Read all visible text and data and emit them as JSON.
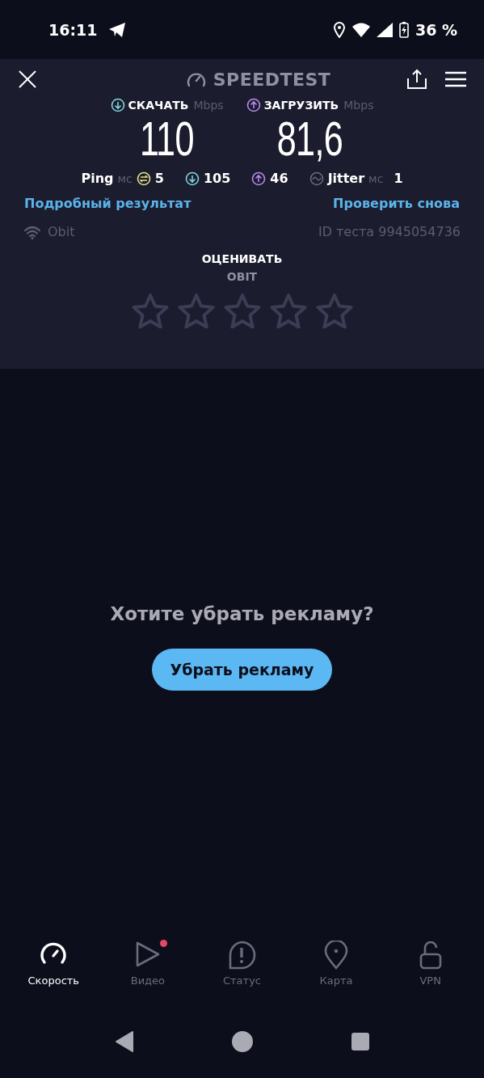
{
  "status_bar": {
    "time": "16:11",
    "battery": "36 %"
  },
  "header": {
    "title": "SPEEDTEST"
  },
  "results": [
    {
      "kind": "download",
      "label": "СКАЧАТЬ",
      "unit": "Mbps",
      "value": "110"
    },
    {
      "kind": "upload",
      "label": "ЗАГРУЗИТЬ",
      "unit": "Mbps",
      "value": "81,6"
    }
  ],
  "ping": {
    "label": "Ping",
    "unit": "мс",
    "idle": "5",
    "download": "105",
    "upload": "46"
  },
  "jitter": {
    "label": "Jitter",
    "unit": "мс",
    "value": "1"
  },
  "links": {
    "details": "Подробный результат",
    "retest": "Проверить снова"
  },
  "provider": "Obit",
  "test_id": "ID теста 9945054736",
  "rating": {
    "title": "ОЦЕНИВАТЬ",
    "subtitle": "OBIT",
    "stars": 0
  },
  "ad": {
    "question": "Хотите убрать рекламу?",
    "button": "Убрать рекламу"
  },
  "nav": [
    {
      "kind": "gauge",
      "label": "Скорость",
      "selected": true,
      "dot": false
    },
    {
      "kind": "play",
      "label": "Видео",
      "selected": false,
      "dot": true
    },
    {
      "kind": "alert",
      "label": "Статус",
      "selected": false,
      "dot": false
    },
    {
      "kind": "pin",
      "label": "Карта",
      "selected": false,
      "dot": false
    },
    {
      "kind": "lock",
      "label": "VPN",
      "selected": false,
      "dot": false
    }
  ]
}
